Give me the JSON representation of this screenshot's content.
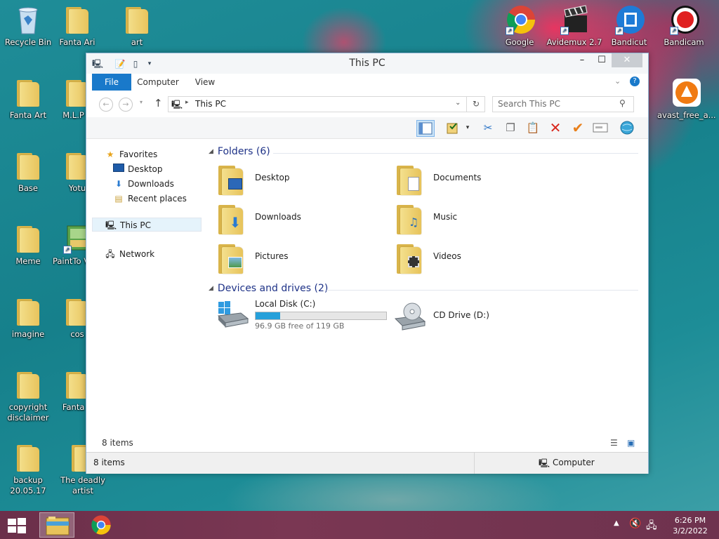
{
  "desktop": {
    "icons": [
      {
        "label": "Recycle Bin"
      },
      {
        "label": "Fanta Ari"
      },
      {
        "label": "art"
      },
      {
        "label": "Fanta Art"
      },
      {
        "label": "M.L.P b"
      },
      {
        "label": "Base"
      },
      {
        "label": "Yotu"
      },
      {
        "label": "Meme"
      },
      {
        "label": "PaintTo Vera"
      },
      {
        "label": "imagine"
      },
      {
        "label": "cos"
      },
      {
        "label": "copyright disclaimer"
      },
      {
        "label": "Fanta Y"
      },
      {
        "label": "backup 20.05.17"
      },
      {
        "label": "The deadly artist"
      },
      {
        "label": "Google"
      },
      {
        "label": "Avidemux 2.7"
      },
      {
        "label": "Bandicut"
      },
      {
        "label": "Bandicam"
      },
      {
        "label": "avast_free_a..."
      }
    ]
  },
  "window": {
    "title": "This PC",
    "ribbon_tabs": [
      "File",
      "Computer",
      "View"
    ],
    "address": "This PC",
    "search_placeholder": "Search This PC",
    "nav": {
      "favorites": "Favorites",
      "desktop": "Desktop",
      "downloads": "Downloads",
      "recent": "Recent places",
      "thispc": "This PC",
      "network": "Network"
    },
    "groups": {
      "folders": "Folders (6)",
      "devices": "Devices and drives (2)"
    },
    "folders": [
      "Desktop",
      "Documents",
      "Downloads",
      "Music",
      "Pictures",
      "Videos"
    ],
    "drives": {
      "c_name": "Local Disk (C:)",
      "c_free": "96.9 GB free of 119 GB",
      "c_used_fraction": 0.186,
      "d_name": "CD Drive (D:)"
    },
    "status_items": "8 items",
    "statusbar_items": "8 items",
    "statusbar_location": "Computer"
  },
  "taskbar": {
    "time": "6:26 PM",
    "date": "3/2/2022"
  },
  "colors": {
    "accent": "#1979ca",
    "group_text": "#1e3287",
    "disk_bar": "#26a0da"
  }
}
